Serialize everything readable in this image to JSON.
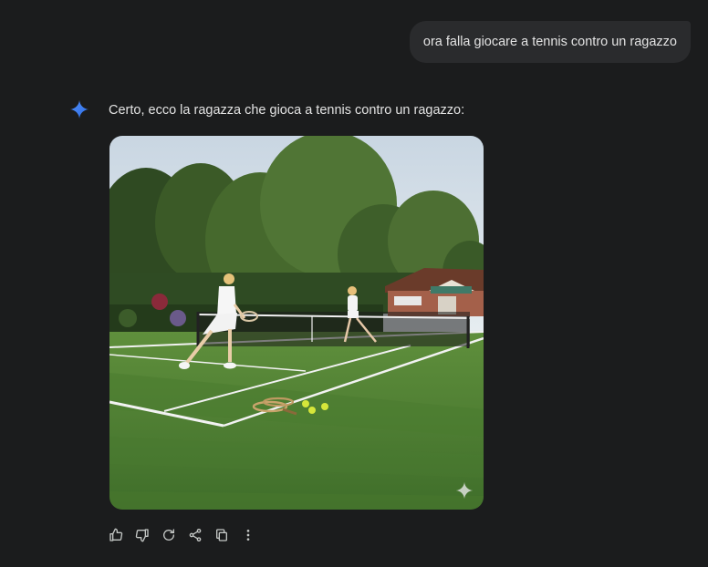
{
  "conversation": {
    "user_message": "ora falla giocare a tennis contro un ragazzo",
    "assistant_message": "Certo, ecco la ragazza che gioca a tennis contro un ragazzo:",
    "generated_image": {
      "subject": "tennis-court-scene"
    }
  },
  "actions": [
    {
      "name": "thumbs-up-icon"
    },
    {
      "name": "thumbs-down-icon"
    },
    {
      "name": "regenerate-icon"
    },
    {
      "name": "share-icon"
    },
    {
      "name": "copy-icon"
    },
    {
      "name": "more-options-icon"
    }
  ],
  "colors": {
    "background": "#1b1c1d",
    "bubble": "#2a2b2d",
    "text": "#e3e3e3",
    "gem_blue": "#4a8cf7",
    "icon_gray": "#c4c7c5"
  }
}
